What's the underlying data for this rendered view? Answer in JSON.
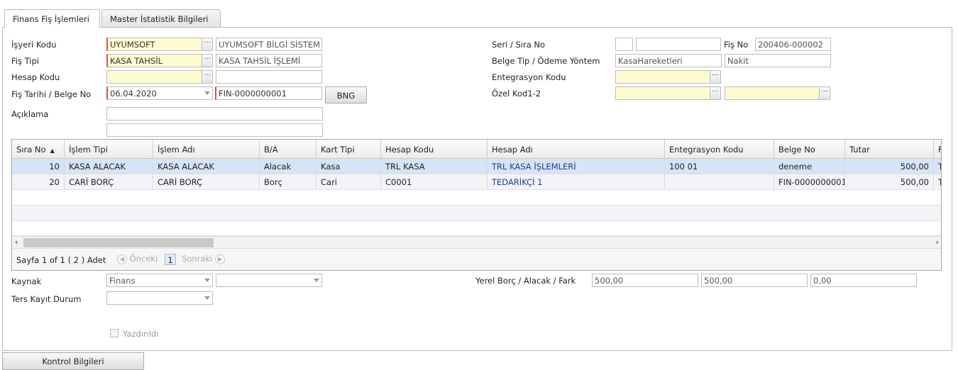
{
  "tabs": [
    {
      "label": "Finans Fiş İşlemleri"
    },
    {
      "label": "Master İstatistik Bilgileri"
    }
  ],
  "form": {
    "isyeri_kodu": {
      "label": "İşyeri Kodu",
      "value": "UYUMSOFT",
      "desc": "UYUMSOFT BİLGİ SİSTEM"
    },
    "fis_tipi": {
      "label": "Fiş Tipi",
      "value": "KASA TAHSİL",
      "desc": "KASA TAHSİL İŞLEMİ"
    },
    "hesap_kodu": {
      "label": "Hesap Kodu",
      "value": "",
      "desc": ""
    },
    "fis_tarihi": {
      "label": "Fiş Tarihi / Belge No",
      "date": "06.04.2020",
      "belge_no": "FIN-0000000001",
      "bng": "BNG"
    },
    "aciklama": {
      "label": "Açıklama",
      "line1": "",
      "line2": ""
    },
    "seri_sira": {
      "label": "Seri / Sıra No",
      "seri": "",
      "sira": ""
    },
    "fis_no": {
      "label": "Fiş No",
      "value": "200406-000002"
    },
    "belge_tip": {
      "label": "Belge Tip / Ödeme Yöntem",
      "tip": "KasaHareketleri",
      "yontem": "Nakit"
    },
    "entegrasyon": {
      "label": "Entegrasyon Kodu",
      "value": ""
    },
    "ozel_kod": {
      "label": "Özel Kod1-2",
      "kod1": "",
      "kod2": ""
    }
  },
  "grid": {
    "columns": [
      "Sıra No",
      "İşlem Tipi",
      "İşlem Adı",
      "B/A",
      "Kart Tipi",
      "Hesap Kodu",
      "Hesap Adı",
      "Entegrasyon Kodu",
      "Belge No",
      "Tutar",
      "F"
    ],
    "sort_icon": "sort-up-icon",
    "rows": [
      {
        "sira": "10",
        "islem_tipi": "KASA ALACAK",
        "islem_adi": "KASA ALACAK",
        "ba": "Alacak",
        "kart_tipi": "Kasa",
        "hesap_kodu": "TRL KASA",
        "hesap_adi": "TRL KASA İŞLEMLERİ",
        "entegrasyon": "100 01",
        "belge_no": "deneme",
        "tutar": "500,00",
        "extra": "T"
      },
      {
        "sira": "20",
        "islem_tipi": "CARİ BORÇ",
        "islem_adi": "CARİ BORÇ",
        "ba": "Borç",
        "kart_tipi": "Cari",
        "hesap_kodu": "C0001",
        "hesap_adi": "TEDARİKÇİ 1",
        "entegrasyon": "",
        "belge_no": "FIN-0000000001",
        "tutar": "500,00",
        "extra": "T"
      }
    ],
    "pager": {
      "text": "Sayfa 1 of 1 ( 2 ) Adet",
      "prev": "Önceki",
      "page": "1",
      "next": "Sonraki"
    }
  },
  "bottom": {
    "kaynak": {
      "label": "Kaynak",
      "value": "Finans",
      "value2": ""
    },
    "ters_kayit": {
      "label": "Ters Kayıt Durum",
      "value": ""
    },
    "yerel": {
      "label": "Yerel Borç / Alacak / Fark",
      "borc": "500,00",
      "alacak": "500,00",
      "fark": "0,00"
    },
    "yazdirildi": {
      "label": "Yazdırıldı"
    },
    "kontrol_button": "Kontrol Bilgileri"
  },
  "colors": {
    "required_bg": "#fffbd0",
    "required_border": "#d9534f",
    "selected_row": "#d6e4f7",
    "link": "#1e3c8c"
  }
}
